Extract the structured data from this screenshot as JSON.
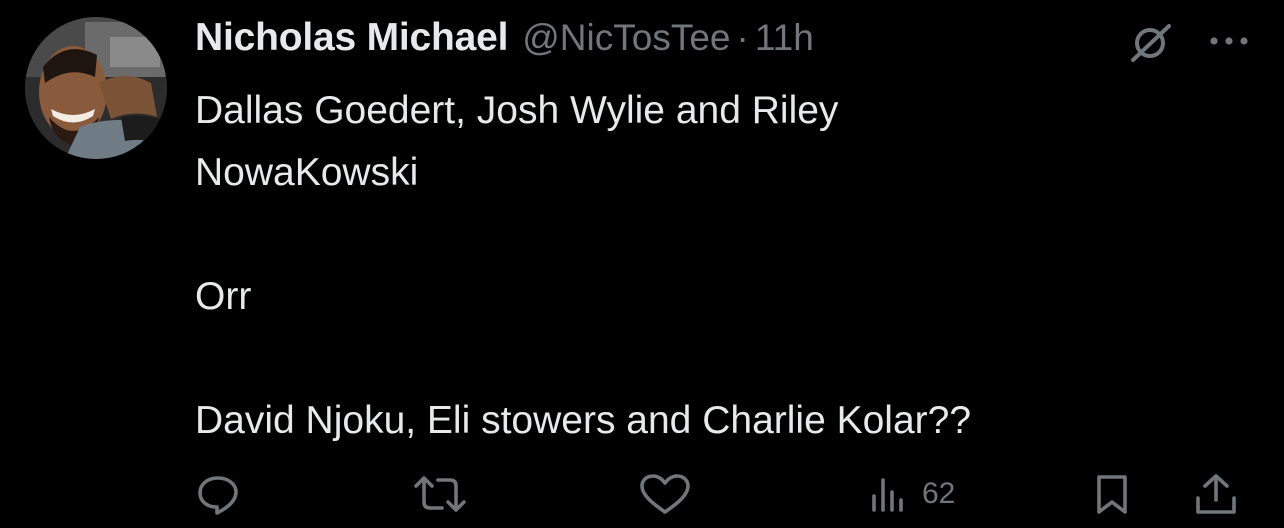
{
  "author": {
    "display_name": "Nicholas Michael",
    "handle": "@NicTosTee",
    "separator": "·",
    "time": "11h"
  },
  "tweet": {
    "lines": [
      "Dallas Goedert, Josh Wylie and Riley",
      "NowaKowski",
      "Orr",
      "David Njoku, Eli stowers and Charlie Kolar??"
    ]
  },
  "actions": {
    "reply_icon": "reply-icon",
    "repost_icon": "repost-icon",
    "like_icon": "heart-icon",
    "views_icon": "views-icon",
    "views_count": "62",
    "bookmark_icon": "bookmark-icon",
    "share_icon": "share-icon"
  },
  "header_icons": {
    "grok": "grok-icon",
    "more": "more-icon"
  },
  "colors": {
    "background": "#000000",
    "text": "#e7e9ea",
    "secondary": "#71767b"
  }
}
